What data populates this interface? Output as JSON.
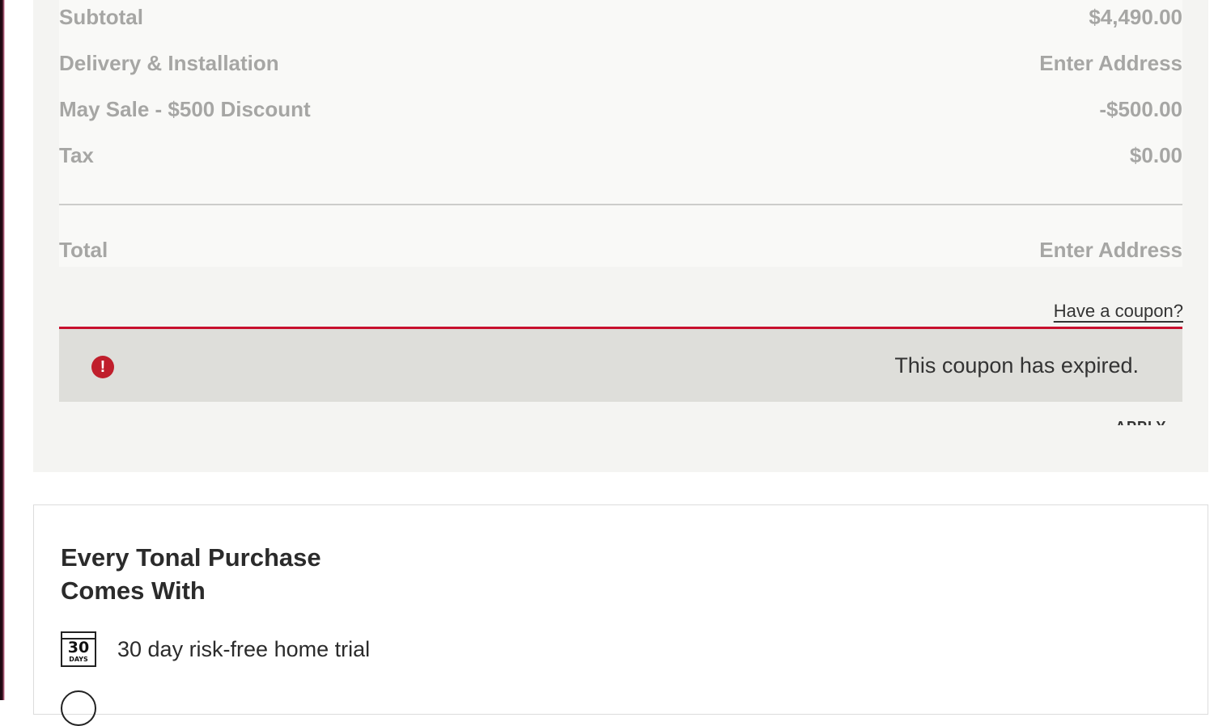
{
  "order_summary": {
    "rows": [
      {
        "label": "Subtotal",
        "value": "$4,490.00"
      },
      {
        "label": "Delivery & Installation",
        "value": "Enter Address"
      },
      {
        "label": "May Sale - $500 Discount",
        "value": "-$500.00"
      },
      {
        "label": "Tax",
        "value": "$0.00"
      }
    ],
    "total": {
      "label": "Total",
      "value": "Enter Address"
    }
  },
  "coupon": {
    "link_label": "Have a coupon?",
    "error_message": "This coupon has expired.",
    "apply_label": "APPLY"
  },
  "benefits": {
    "title": "Every Tonal Purchase Comes With",
    "items": [
      {
        "icon": "calendar-30-days-icon",
        "icon_number": "30",
        "icon_caption": "DAYS",
        "text": "30 day risk-free home trial"
      }
    ]
  },
  "colors": {
    "accent_red": "#c8102e",
    "alert_background": "#dededa",
    "summary_background": "#f4f4f2",
    "muted_text": "#a6a6a4"
  }
}
